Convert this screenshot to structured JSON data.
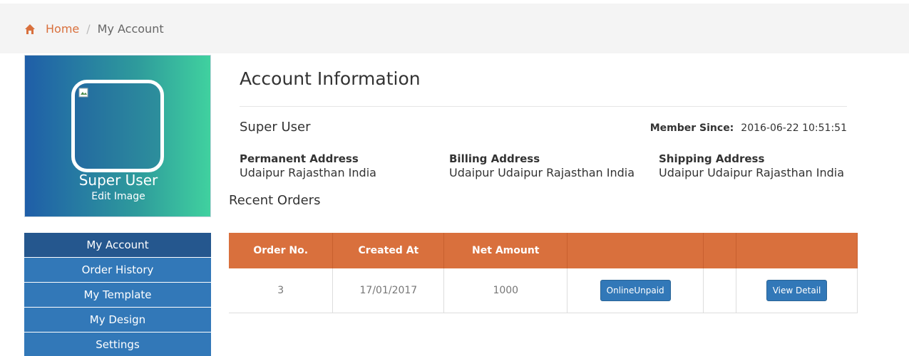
{
  "breadcrumb": {
    "home": "Home",
    "separator": "/",
    "current": "My Account"
  },
  "profile": {
    "name": "Super User",
    "edit_image": "Edit Image"
  },
  "menu": [
    {
      "label": "My Account",
      "active": true
    },
    {
      "label": "Order History"
    },
    {
      "label": "My Template"
    },
    {
      "label": "My Design"
    },
    {
      "label": "Settings"
    }
  ],
  "account": {
    "title": "Account Information",
    "user_name": "Super User",
    "member_since_label": "Member Since:",
    "member_since_value": "2016-06-22 10:51:51",
    "permanent_label": "Permanent Address",
    "permanent_value": "Udaipur Rajasthan India",
    "billing_label": "Billing Address",
    "billing_value": "Udaipur Udaipur Rajasthan India",
    "shipping_label": "Shipping Address",
    "shipping_value": "Udaipur Udaipur Rajasthan India"
  },
  "orders": {
    "title": "Recent Orders",
    "headers": [
      "Order No.",
      "Created At",
      "Net Amount",
      "",
      "",
      ""
    ],
    "rows": [
      {
        "order_no": "3",
        "created_at": "17/01/2017",
        "net_amount": "1000",
        "status_button": "OnlineUnpaid",
        "detail_button": "View Detail"
      }
    ]
  },
  "colors": {
    "accent": "#d9703d",
    "menu_blue": "#3278b8",
    "menu_active": "#25578e"
  },
  "icons": {
    "home": "home-icon",
    "broken_image": "broken-image-icon"
  }
}
